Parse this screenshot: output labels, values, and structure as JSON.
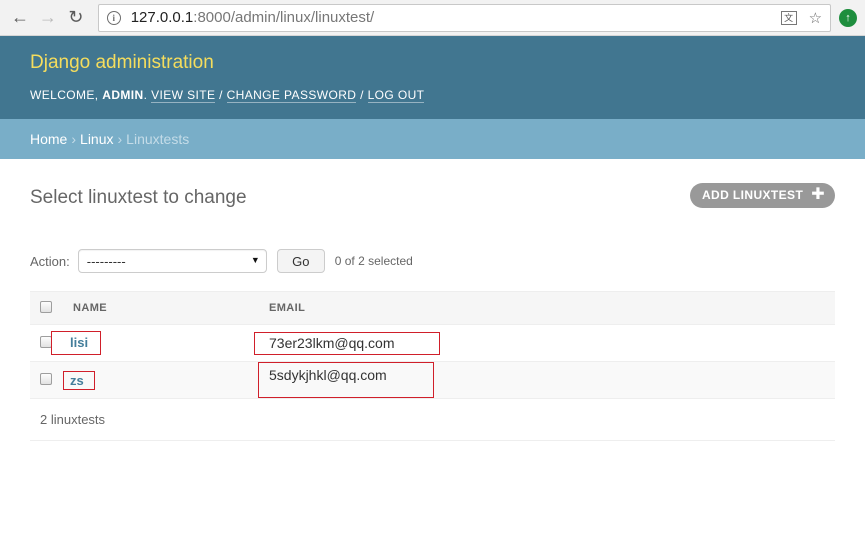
{
  "browser": {
    "url_host": "127.0.0.1",
    "url_rest": ":8000/admin/linux/linuxtest/",
    "back_icon": "←",
    "forward_icon": "→",
    "reload_icon": "↻",
    "star_icon": "☆",
    "ext_icon": "↑"
  },
  "header": {
    "branding": "Django administration",
    "welcome": "Welcome,",
    "user": "admin",
    "view_site": "View site",
    "change_password": "Change password",
    "log_out": "Log out"
  },
  "breadcrumbs": {
    "home": "Home",
    "app": "Linux",
    "current": "Linuxtests",
    "sep": "›"
  },
  "main": {
    "title": "Select linuxtest to change",
    "add_button": "Add linuxtest",
    "add_icon": "✚",
    "action_label": "Action:",
    "action_selected": "---------",
    "go_label": "Go",
    "selected_count": "0 of 2 selected"
  },
  "table": {
    "columns": [
      "Name",
      "Email"
    ],
    "rows": [
      {
        "name": "lisi",
        "email": "73er23lkm@qq.com"
      },
      {
        "name": "zs",
        "email": "5sdykjhkl@qq.com"
      }
    ],
    "footer": "2 linuxtests"
  },
  "colors": {
    "header_bg": "#417690",
    "branding": "#f5dd5d",
    "breadcrumbs_bg": "#79aec8",
    "link": "#447e9b",
    "annotation": "#d01f2a"
  }
}
